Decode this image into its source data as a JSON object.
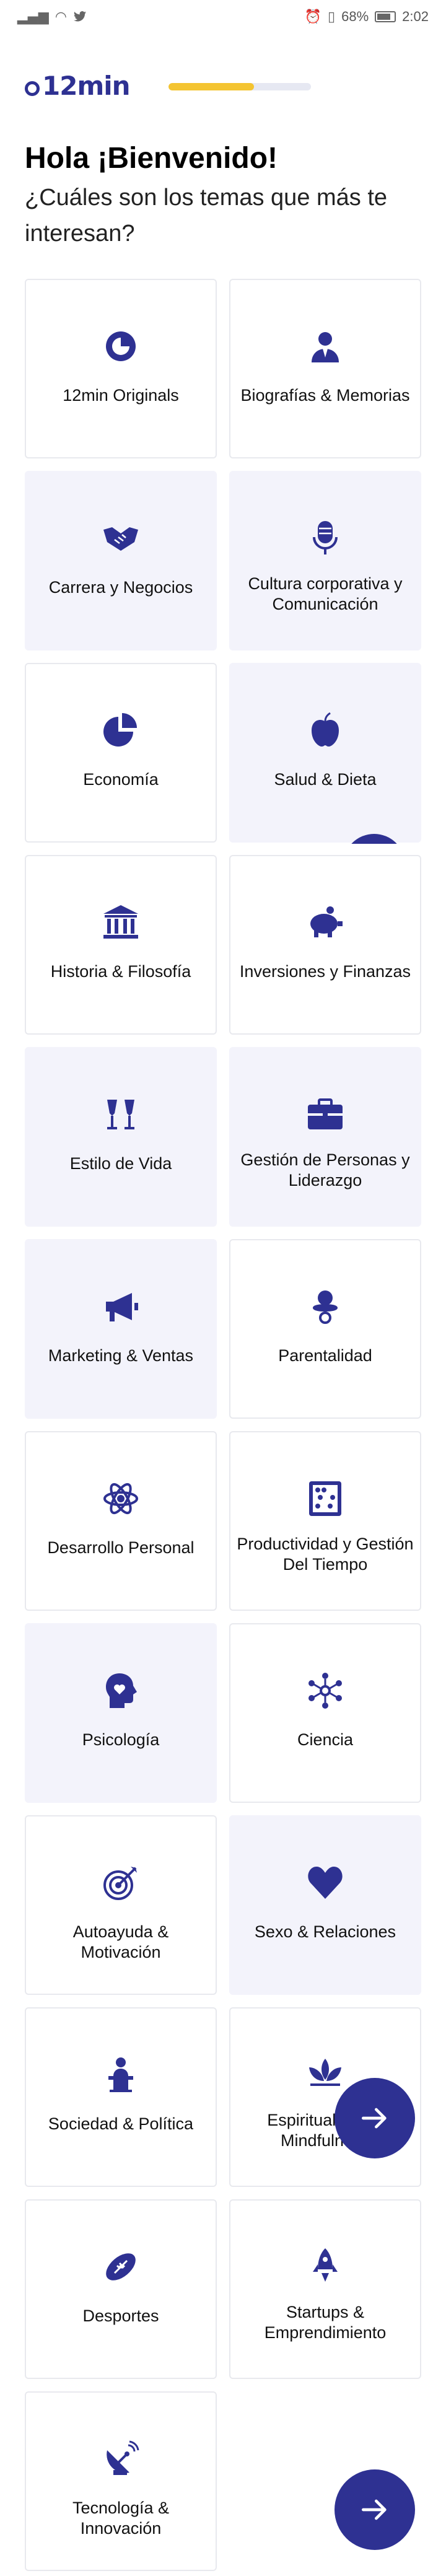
{
  "status_bar": {
    "battery": "68%",
    "time": "2:02",
    "left_icons": [
      "signal-icon",
      "wifi-icon",
      "twitter-icon"
    ],
    "right_icons": [
      "alarm-icon",
      "vibrate-icon",
      "battery-icon"
    ]
  },
  "header": {
    "logo_text": "12min",
    "onboarding_progress": 0.6
  },
  "greeting": {
    "title": "Hola ¡Bienvenido!",
    "subtitle": "¿Cuáles son los temas que más te interesan?"
  },
  "colors": {
    "brand": "#2e3192",
    "progress_fill": "#f4c431",
    "selected_card": "#f3f3fb"
  },
  "topics": [
    {
      "label": "12min Originals",
      "icon": "12min-logo-icon",
      "selected": false
    },
    {
      "label": "Biografías & Memorias",
      "icon": "person-bust-icon",
      "selected": false
    },
    {
      "label": "Carrera y Negocios",
      "icon": "handshake-icon",
      "selected": true
    },
    {
      "label": "Cultura corporativa y Comunicación",
      "icon": "microphone-icon",
      "selected": true
    },
    {
      "label": "Economía",
      "icon": "pie-chart-icon",
      "selected": false
    },
    {
      "label": "Salud & Dieta",
      "icon": "apple-icon",
      "selected": true
    },
    {
      "label": "Historia & Filosofía",
      "icon": "museum-icon",
      "selected": false
    },
    {
      "label": "Inversiones y Finanzas",
      "icon": "piggy-bank-icon",
      "selected": false
    },
    {
      "label": "Estilo de Vida",
      "icon": "champagne-glasses-icon",
      "selected": true
    },
    {
      "label": "Gestión de Personas y Liderazgo",
      "icon": "briefcase-icon",
      "selected": true
    },
    {
      "label": "Marketing & Ventas",
      "icon": "megaphone-icon",
      "selected": true
    },
    {
      "label": "Parentalidad",
      "icon": "pacifier-icon",
      "selected": false
    },
    {
      "label": "Desarrollo Personal",
      "icon": "atom-icon",
      "selected": false
    },
    {
      "label": "Productividad y Gestión Del Tiempo",
      "icon": "abacus-icon",
      "selected": false
    },
    {
      "label": "Psicología",
      "icon": "head-heart-icon",
      "selected": true
    },
    {
      "label": "Ciencia",
      "icon": "molecule-icon",
      "selected": false
    },
    {
      "label": "Autoayuda & Motivación",
      "icon": "target-icon",
      "selected": false
    },
    {
      "label": "Sexo & Relaciones",
      "icon": "heart-icon",
      "selected": true
    },
    {
      "label": "Sociedad & Política",
      "icon": "podium-speaker-icon",
      "selected": false
    },
    {
      "label": "Espiritualidad & Mindfulness",
      "icon": "lotus-icon",
      "selected": false
    },
    {
      "label": "Desportes",
      "icon": "football-icon",
      "selected": false
    },
    {
      "label": "Startups & Emprendimiento",
      "icon": "rocket-icon",
      "selected": false
    },
    {
      "label": "Tecnología & Innovación",
      "icon": "satellite-dish-icon",
      "selected": false
    }
  ],
  "next_button": {
    "icon": "arrow-right-icon"
  }
}
